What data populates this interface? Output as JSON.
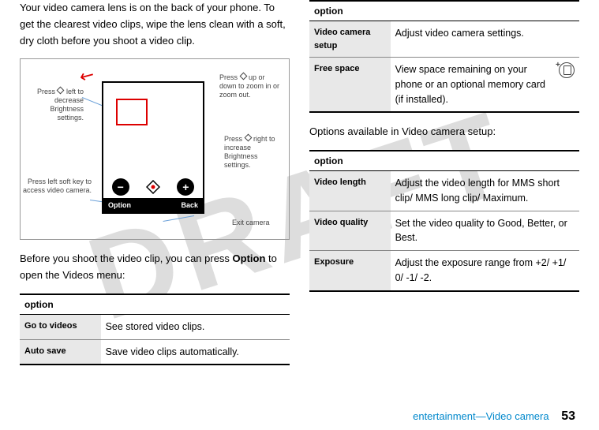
{
  "watermark": "DRAFT",
  "left": {
    "intro": "Your video camera lens is on the back of your phone. To get the clearest video clips, wipe the lens clean with a soft, dry cloth before you shoot a video clip.",
    "before_text_pre": "Before you shoot the video clip, you can press ",
    "before_option": "Option",
    "before_text_post": " to open the Videos menu:",
    "diagram": {
      "soft_left": "Option",
      "soft_right": "Back",
      "callout_left1": "Press    left to decrease Brightness settings.",
      "callout_left2": "Press left soft key to access video camera.",
      "callout_right1": "Press    up or down to zoom in or zoom out.",
      "callout_right2": "Press    right to increase Brightness settings.",
      "callout_right3": "Exit camera"
    },
    "table1": {
      "header": "option",
      "rows": [
        {
          "label": "Go to videos",
          "desc": "See stored video clips."
        },
        {
          "label": "Auto save",
          "desc": "Save video clips automatically."
        }
      ]
    }
  },
  "right": {
    "table2": {
      "header": "option",
      "rows": [
        {
          "label": "Video camera setup",
          "desc": "Adjust video camera settings."
        },
        {
          "label": "Free space",
          "desc": "View space remaining on your phone or an optional memory card (if installed)."
        }
      ]
    },
    "setup_intro": "Options available in Video camera setup:",
    "table3": {
      "header": "option",
      "rows": [
        {
          "label": "Video length",
          "desc": "Adjust the video length for MMS short clip/ MMS long clip/ Maximum."
        },
        {
          "label": "Video quality",
          "desc": "Set the video quality to Good, Better, or Best."
        },
        {
          "label": "Exposure",
          "desc": "Adjust the exposure range from +2/ +1/ 0/ -1/ -2."
        }
      ]
    }
  },
  "footer": {
    "section": "entertainment—Video camera",
    "page": "53"
  }
}
